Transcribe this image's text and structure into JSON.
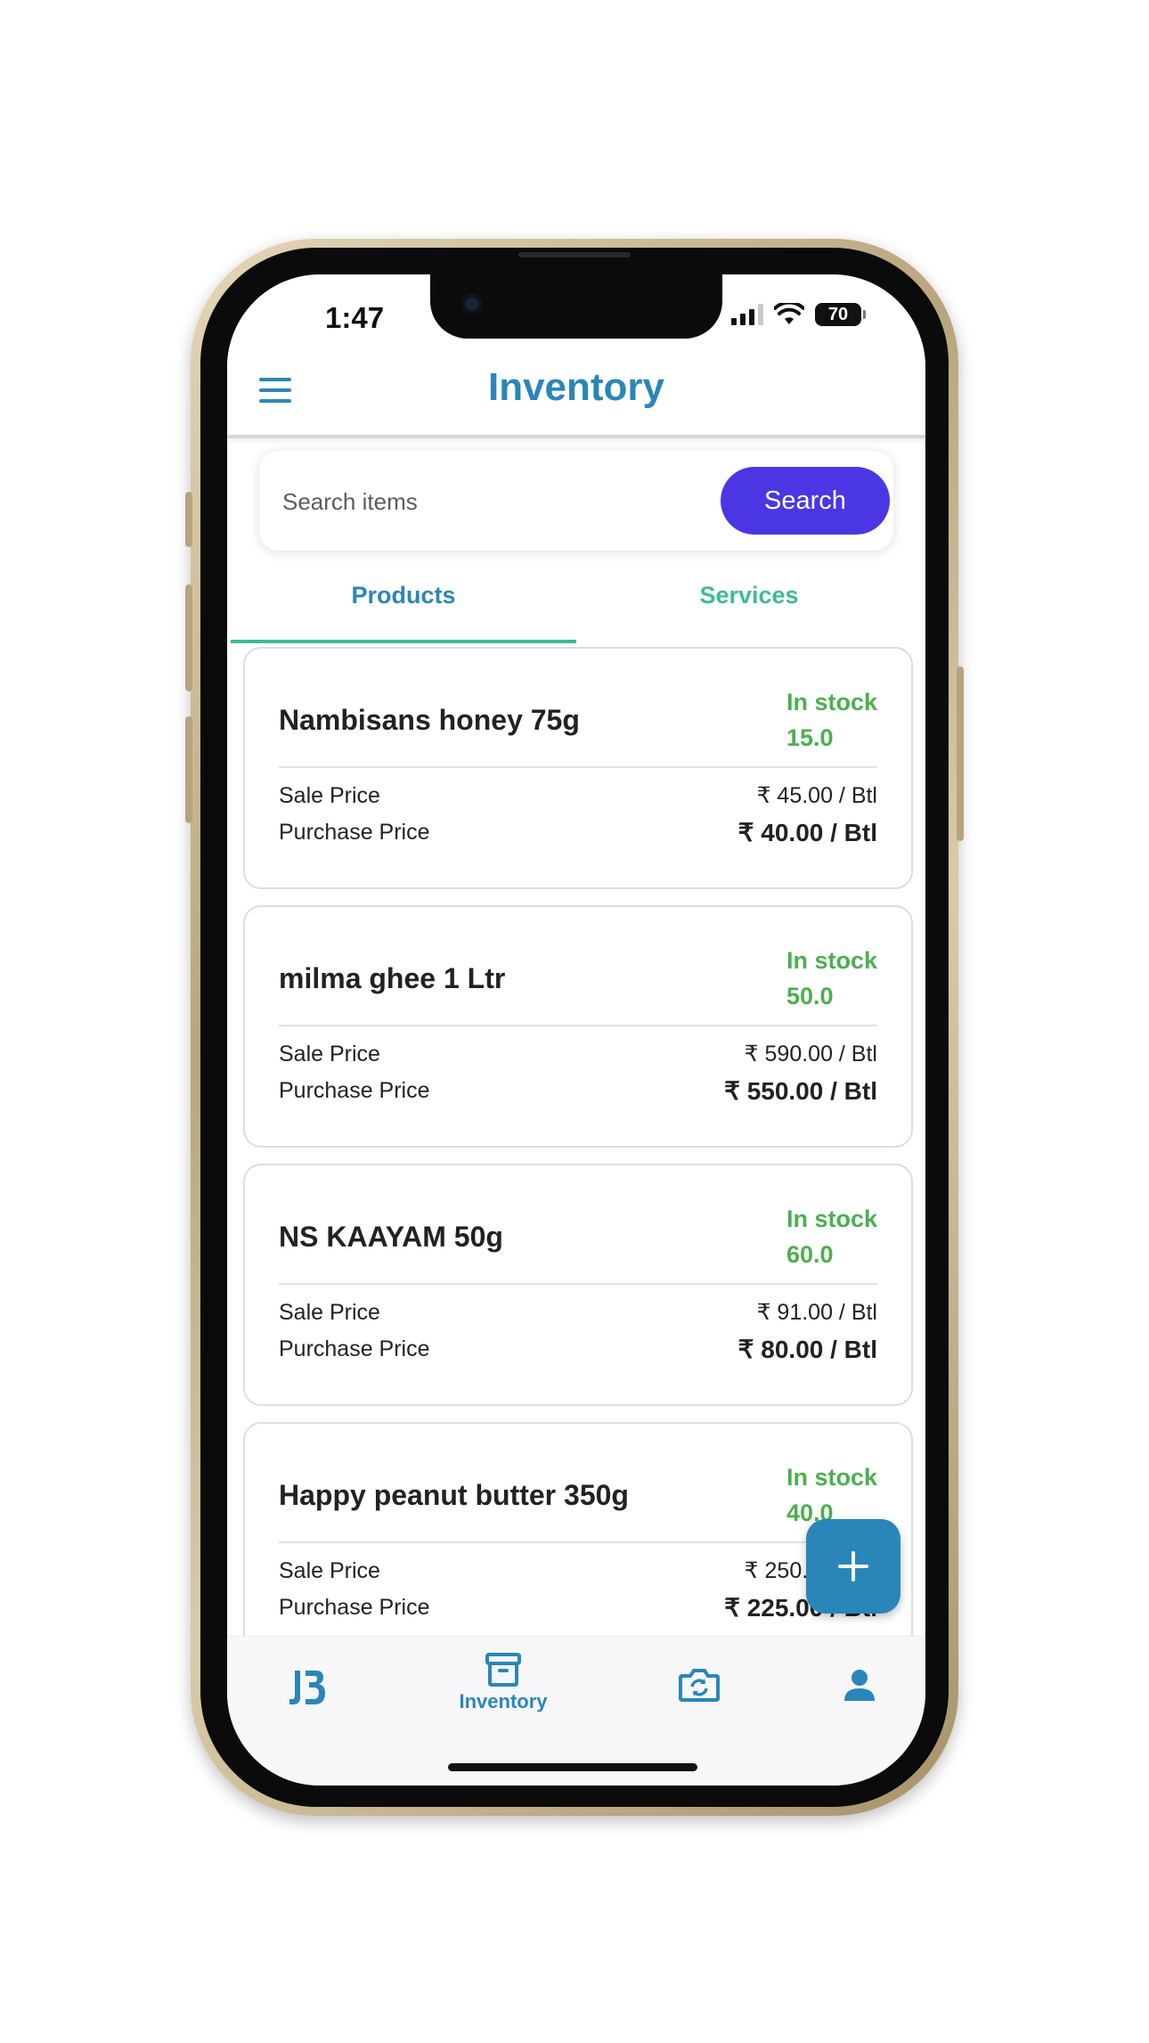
{
  "status_bar": {
    "time": "1:47",
    "battery": "70"
  },
  "app_bar": {
    "title": "Inventory",
    "menu_icon": "hamburger-menu-icon"
  },
  "search": {
    "placeholder": "Search items",
    "value": "",
    "button_label": "Search"
  },
  "tabs": [
    {
      "label": "Products",
      "active": true
    },
    {
      "label": "Services",
      "active": false
    }
  ],
  "labels": {
    "sale_price": "Sale Price",
    "purchase_price": "Purchase Price"
  },
  "products": [
    {
      "name": "Nambisans honey 75g",
      "stock_label": "In stock",
      "stock_qty": "15.0",
      "sale_price": "₹ 45.00 / Btl",
      "purchase_price": "₹ 40.00 / Btl"
    },
    {
      "name": "milma ghee 1 Ltr",
      "stock_label": "In stock",
      "stock_qty": "50.0",
      "sale_price": "₹ 590.00 / Btl",
      "purchase_price": "₹ 550.00 / Btl"
    },
    {
      "name": "NS KAAYAM 50g",
      "stock_label": "In stock",
      "stock_qty": "60.0",
      "sale_price": "₹ 91.00 / Btl",
      "purchase_price": "₹ 80.00 / Btl"
    },
    {
      "name": "Happy peanut butter 350g",
      "stock_label": "In stock",
      "stock_qty": "40.0",
      "sale_price": "₹ 250.00 / Btl",
      "purchase_price": "₹ 225.00 / Btl"
    }
  ],
  "fab": {
    "icon": "plus-icon"
  },
  "bottom_nav": [
    {
      "icon": "jb-logo-icon",
      "label": ""
    },
    {
      "icon": "archive-box-icon",
      "label": "Inventory",
      "active": true
    },
    {
      "icon": "camera-sync-icon",
      "label": ""
    },
    {
      "icon": "person-icon",
      "label": ""
    }
  ],
  "colors": {
    "primary": "#2a86b9",
    "search_button": "#4a37e3",
    "tab_accent": "#3dbb97",
    "in_stock": "#4caf50",
    "phone_frame": "#c8b68e"
  }
}
